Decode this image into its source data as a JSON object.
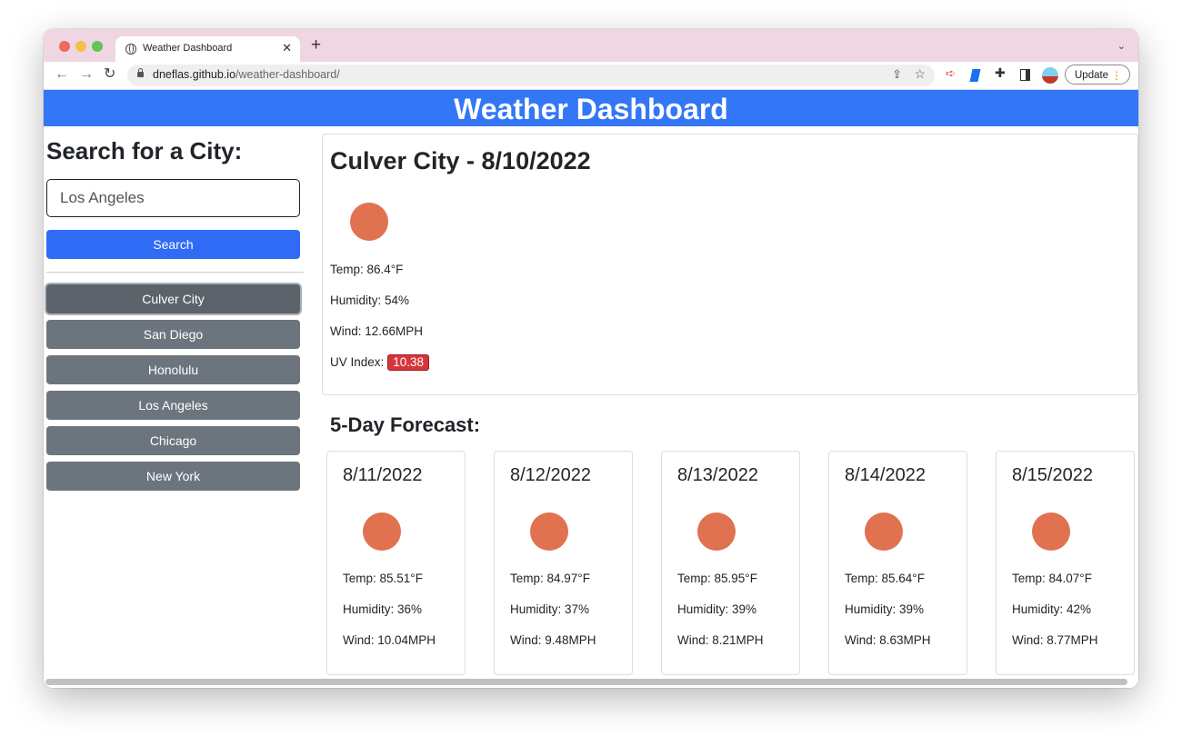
{
  "browser": {
    "tab_title": "Weather Dashboard",
    "url_host": "dneflas.github.io",
    "url_path": "/weather-dashboard/",
    "update_label": "Update"
  },
  "header": {
    "title": "Weather Dashboard"
  },
  "sidebar": {
    "search_title": "Search for a City:",
    "search_value": "Los Angeles",
    "search_button": "Search",
    "cities": [
      "Culver City",
      "San Diego",
      "Honolulu",
      "Los Angeles",
      "Chicago",
      "New York"
    ],
    "active_city": "Culver City"
  },
  "current": {
    "title": "Culver City - 8/10/2022",
    "temp": "Temp: 86.4°F",
    "humidity": "Humidity: 54%",
    "wind": "Wind: 12.66MPH",
    "uv_label": "UV Index:",
    "uv_value": "10.38",
    "uv_color": "#d6363b"
  },
  "forecast": {
    "title": "5-Day Forecast:",
    "days": [
      {
        "date": "8/11/2022",
        "temp": "Temp: 85.51°F",
        "humidity": "Humidity: 36%",
        "wind": "Wind: 10.04MPH"
      },
      {
        "date": "8/12/2022",
        "temp": "Temp: 84.97°F",
        "humidity": "Humidity: 37%",
        "wind": "Wind: 9.48MPH"
      },
      {
        "date": "8/13/2022",
        "temp": "Temp: 85.95°F",
        "humidity": "Humidity: 39%",
        "wind": "Wind: 8.21MPH"
      },
      {
        "date": "8/14/2022",
        "temp": "Temp: 85.64°F",
        "humidity": "Humidity: 39%",
        "wind": "Wind: 8.63MPH"
      },
      {
        "date": "8/15/2022",
        "temp": "Temp: 84.07°F",
        "humidity": "Humidity: 42%",
        "wind": "Wind: 8.77MPH"
      }
    ]
  },
  "colors": {
    "header": "#3377f6",
    "search_button": "#2f6bf5",
    "city_button": "#6c757d",
    "weather_icon": "#e07250"
  }
}
